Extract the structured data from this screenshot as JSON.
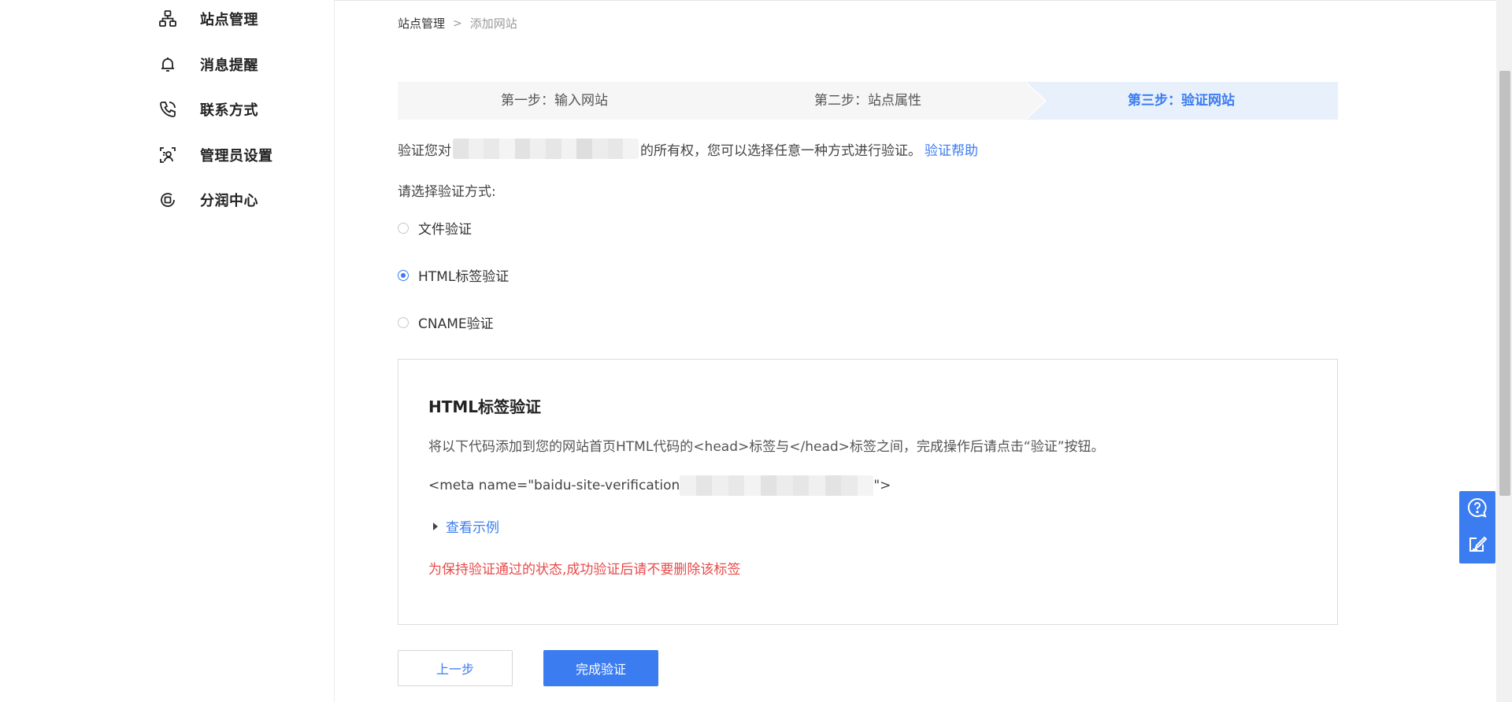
{
  "sidebar": {
    "items": [
      {
        "label": "站点管理",
        "icon": "site-structure-icon"
      },
      {
        "label": "消息提醒",
        "icon": "bell-icon"
      },
      {
        "label": "联系方式",
        "icon": "phone-icon"
      },
      {
        "label": "管理员设置",
        "icon": "admin-user-icon"
      },
      {
        "label": "分润中心",
        "icon": "revenue-share-icon"
      }
    ]
  },
  "breadcrumb": {
    "items": [
      "站点管理",
      "添加网站"
    ],
    "separator": ">"
  },
  "steps": [
    {
      "label": "第一步：输入网站",
      "active": false
    },
    {
      "label": "第二步：站点属性",
      "active": false
    },
    {
      "label": "第三步：验证网站",
      "active": true
    }
  ],
  "verify_intro": {
    "prefix": "验证您对",
    "suffix": "的所有权，您可以选择任意一种方式进行验证。",
    "help_link": "验证帮助"
  },
  "method_label": "请选择验证方式:",
  "methods": [
    {
      "label": "文件验证",
      "selected": false
    },
    {
      "label": "HTML标签验证",
      "selected": true
    },
    {
      "label": "CNAME验证",
      "selected": false
    }
  ],
  "panel": {
    "title": "HTML标签验证",
    "description": "将以下代码添加到您的网站首页HTML代码的<head>标签与</head>标签之间，完成操作后请点击“验证”按钮。",
    "meta_prefix": "<meta name=\"baidu-site-verification",
    "meta_suffix": "\">",
    "example_link": "查看示例",
    "warning": "为保持验证通过的状态,成功验证后请不要删除该标签"
  },
  "buttons": {
    "prev": "上一步",
    "finish": "完成验证"
  },
  "float_tools": [
    {
      "icon": "help-chat-icon"
    },
    {
      "icon": "feedback-edit-icon"
    }
  ],
  "colors": {
    "accent": "#3b7cf0",
    "warning": "#e84a4a",
    "active_step_bg": "#e8f0fc",
    "step_bg": "#f6f6f6"
  }
}
